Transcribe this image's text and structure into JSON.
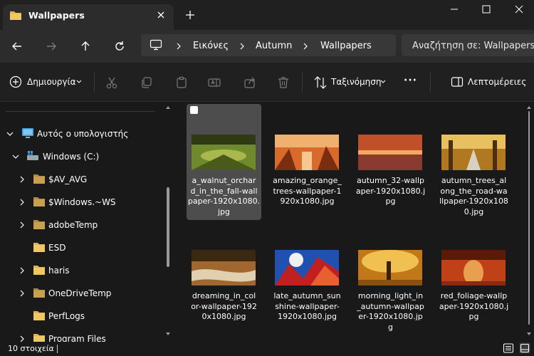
{
  "window": {
    "tab_title": "Wallpapers",
    "new_tab_symbol": "+"
  },
  "address": {
    "crumbs": [
      "Εικόνες",
      "Autumn",
      "Wallpapers"
    ],
    "search_placeholder": "Αναζήτηση σε: Wallpapers"
  },
  "toolbar": {
    "new_label": "Δημιουργία",
    "sort_label": "Ταξινόμηση",
    "more_label": "···",
    "details_label": "Λεπτομέρειες"
  },
  "sidebar": {
    "items": [
      {
        "label": "Αυτός ο υπολογιστής",
        "icon": "computer-icon"
      },
      {
        "label": "Windows (C:)",
        "icon": "drive-icon"
      },
      {
        "label": "$AV_AVG",
        "icon": "folder-icon"
      },
      {
        "label": "$Windows.~WS",
        "icon": "folder-icon"
      },
      {
        "label": "adobeTemp",
        "icon": "folder-icon"
      },
      {
        "label": "ESD",
        "icon": "folder-icon"
      },
      {
        "label": "haris",
        "icon": "folder-icon"
      },
      {
        "label": "OneDriveTemp",
        "icon": "folder-icon"
      },
      {
        "label": "PerfLogs",
        "icon": "folder-icon"
      },
      {
        "label": "Program Files",
        "icon": "folder-icon"
      }
    ]
  },
  "files": [
    {
      "name": "a_walnut_orchard_in_the_fall-wallpaper-1920x1080.jpg",
      "lines": [
        "a_walnut_orchar",
        "d_in_the_fall-wall",
        "paper-1920x1080.",
        "jpg"
      ],
      "selected": true,
      "colors": [
        "#2f3a14",
        "#6e8a2a",
        "#a9b84c"
      ]
    },
    {
      "name": "amazing_orange_trees-wallpaper-1920x1080.jpg",
      "lines": [
        "amazing_orange_",
        "trees-wallpaper-1",
        "920x1080.jpg"
      ],
      "selected": false,
      "colors": [
        "#7a2d10",
        "#d86a2c",
        "#f0b070"
      ]
    },
    {
      "name": "autumn_32-wallpaper-1920x1080.jpg",
      "lines": [
        "autumn_32-wallp",
        "aper-1920x1080.j",
        "pg"
      ],
      "selected": false,
      "colors": [
        "#3a1a28",
        "#c0502a",
        "#f4a860"
      ]
    },
    {
      "name": "autumn_trees_along_the_road-wallpaper-1920x1080.jpg",
      "lines": [
        "autumn_trees_al",
        "ong_the_road-wa",
        "llpaper-1920x108",
        "0.jpg"
      ],
      "selected": false,
      "colors": [
        "#4a3010",
        "#b07820",
        "#e8c060"
      ]
    },
    {
      "name": "dreaming_in_color-wallpaper-1920x1080.jpg",
      "lines": [
        "dreaming_in_col",
        "or-wallpaper-192",
        "0x1080.jpg"
      ],
      "selected": false,
      "colors": [
        "#3a2810",
        "#a06830",
        "#e0d0b0"
      ]
    },
    {
      "name": "late_autumn_sunshine-wallpaper-1920x1080.jpg",
      "lines": [
        "late_autumn_sun",
        "shine-wallpaper-",
        "1920x1080.jpg"
      ],
      "selected": false,
      "colors": [
        "#2050b0",
        "#c02020",
        "#e86030"
      ]
    },
    {
      "name": "morning_light_in_autumn-wallpaper-1920x1080.jpg",
      "lines": [
        "morning_light_in",
        "_autumn-wallpap",
        "er-1920x1080.jp",
        "g"
      ],
      "selected": false,
      "colors": [
        "#3a2008",
        "#c07818",
        "#f0c050"
      ]
    },
    {
      "name": "red_foliage-wallpaper-1920x1080.jpg",
      "lines": [
        "red_foliage-wallp",
        "aper-1920x1080.j",
        "pg"
      ],
      "selected": false,
      "colors": [
        "#5a1a08",
        "#c04018",
        "#e8a050"
      ]
    }
  ],
  "status": {
    "count_label": "10 στοιχεία"
  },
  "colors": {
    "folder": "#dcb35c",
    "selection": "#4d4d4d",
    "accent": "#4aa0e6"
  }
}
